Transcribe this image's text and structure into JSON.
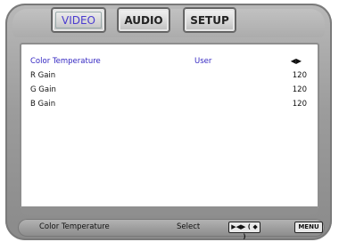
{
  "tabs": [
    {
      "label": "VIDEO",
      "active": true
    },
    {
      "label": "AUDIO",
      "active": false
    },
    {
      "label": "SETUP",
      "active": false
    }
  ],
  "menu": {
    "rows": [
      {
        "label": "Color Temperature",
        "value": "User",
        "arrows": "◀▶",
        "selected": true
      },
      {
        "label": "R Gain",
        "value": "120",
        "selected": false
      },
      {
        "label": "G Gain",
        "value": "120",
        "selected": false
      },
      {
        "label": "B Gain",
        "value": "120",
        "selected": false
      }
    ]
  },
  "statusbar": {
    "title": "Color Temperature",
    "select_label": "Select",
    "keys_label": "▶◀▶ ( ◆ )",
    "menu_label": "MENU"
  },
  "colors": {
    "accent": "#3427c2",
    "frame": "#9c9c9c",
    "panel": "#ffffff"
  }
}
